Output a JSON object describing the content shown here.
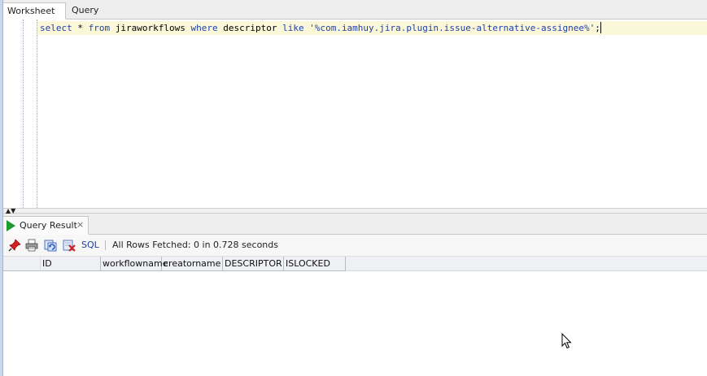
{
  "worksheet_tabs": [
    {
      "label": "Worksheet"
    },
    {
      "label": "Query Builder"
    }
  ],
  "editor": {
    "sql": {
      "kw_select": "select",
      "star": " * ",
      "kw_from": "from",
      "table": " jiraworkflows ",
      "kw_where": "where",
      "column": " descriptor ",
      "kw_like": "like",
      "space": " ",
      "pattern": "'%com.iamhuy.jira.plugin.issue-alternative-assignee%'",
      "terminator": ";"
    }
  },
  "results": {
    "tab_label": "Query Result",
    "close_glyph": "×",
    "toolbar": {
      "sql_label": "SQL",
      "separator": "|",
      "status": "All Rows Fetched: 0 in 0.728 seconds"
    },
    "columns": [
      "ID",
      "workflowname",
      "creatorname",
      "DESCRIPTOR",
      "ISLOCKED"
    ]
  },
  "colors": {
    "keyword": "#1f3fa8",
    "run_icon": "#1e9b2e",
    "current_line": "#fbf8d9",
    "link": "#1d3ca3"
  }
}
